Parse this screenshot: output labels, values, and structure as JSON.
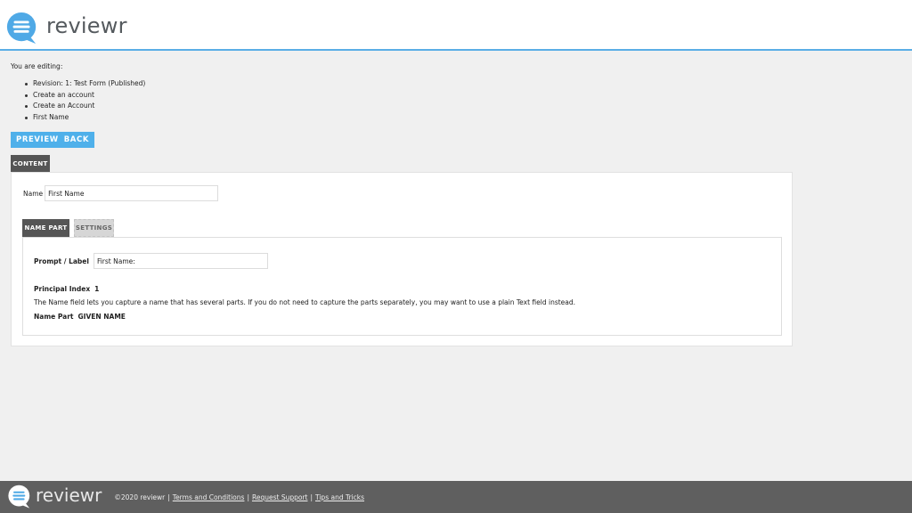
{
  "header": {
    "brand": "reviewr",
    "logo_icon": "chat-bubble-lines-icon",
    "accent_color": "#5aaee6"
  },
  "editing": {
    "label": "You are editing:",
    "crumbs": [
      "Revision: 1: Test Form (Published)",
      "Create an account",
      "Create an Account",
      "First Name"
    ]
  },
  "actions": {
    "preview_label": "PREVIEW",
    "back_label": "BACK",
    "bar_color": "#4fb0ea"
  },
  "main_tabs": [
    {
      "label": "CONTENT",
      "active": true
    }
  ],
  "content": {
    "name_label": "Name",
    "name_value": "First Name",
    "sub_tabs": [
      {
        "label": "NAME PART",
        "active": true
      },
      {
        "label": "SETTINGS",
        "active": false
      }
    ],
    "prompt_label": "Prompt / Label",
    "prompt_value": "First Name:",
    "principal_index_label": "Principal Index",
    "principal_index_value": "1",
    "help_text": "The Name field lets you capture a name that has several parts. If you do not need to capture the parts separately, you may want to use a plain Text field instead.",
    "name_part_label": "Name Part",
    "name_part_value": "GIVEN NAME"
  },
  "footer": {
    "brand": "reviewr",
    "copyright": "©2020 reviewr",
    "separator": "|",
    "links": [
      "Terms and Conditions",
      "Request Support",
      "Tips and Tricks"
    ]
  }
}
